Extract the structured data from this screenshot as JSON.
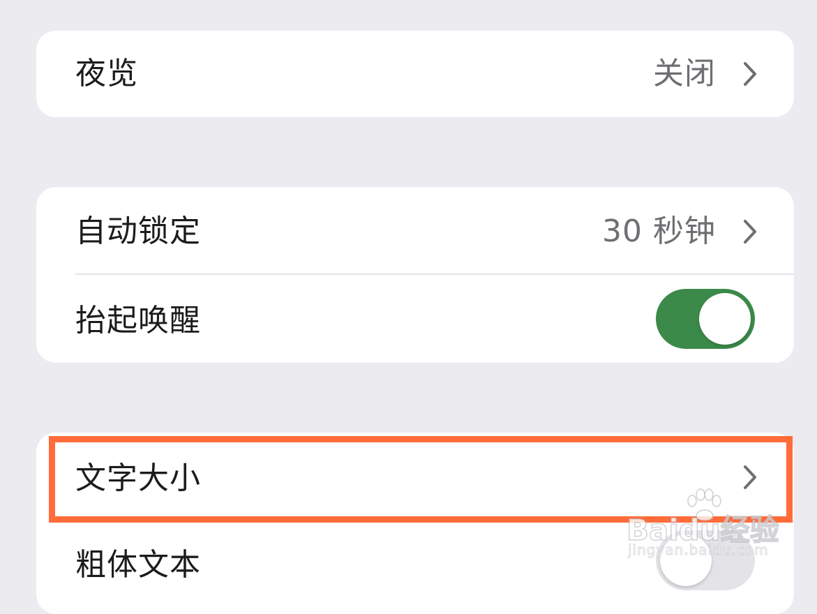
{
  "groups": [
    {
      "rows": [
        {
          "label": "夜览",
          "value": "关闭",
          "accessory": "chevron-right-icon"
        }
      ]
    },
    {
      "rows": [
        {
          "label": "自动锁定",
          "value": "30 秒钟",
          "accessory": "chevron-right-icon"
        },
        {
          "label": "抬起唤醒",
          "accessory": "toggle",
          "toggle_on": true
        }
      ]
    },
    {
      "rows": [
        {
          "label": "文字大小",
          "accessory": "chevron-right-icon",
          "highlighted": true
        },
        {
          "label": "粗体文本",
          "accessory": "toggle",
          "toggle_on": false
        }
      ]
    }
  ],
  "watermark": {
    "brand": "Baidu经验",
    "url": "jingyan.baidu.com"
  },
  "colors": {
    "background": "#ebebf0",
    "card": "#ffffff",
    "toggle_on": "#3c8a4a",
    "toggle_off": "#e3e3e8",
    "secondary_text": "#6e6e73",
    "highlight_border": "#ff6c3a"
  }
}
